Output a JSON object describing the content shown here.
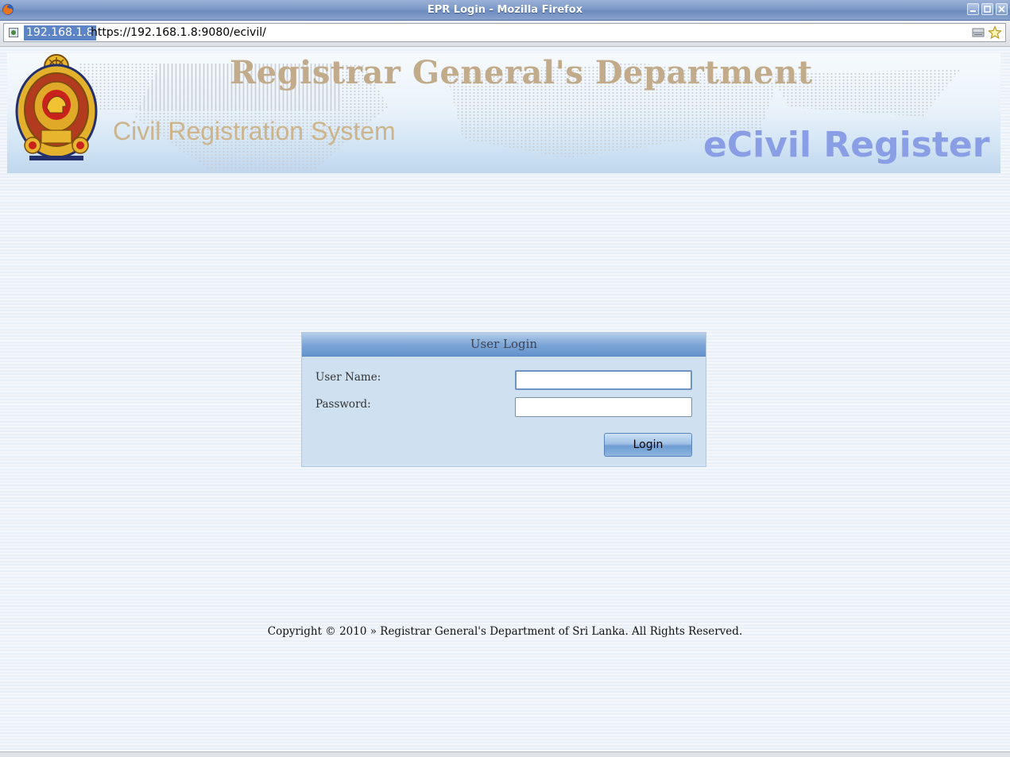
{
  "window": {
    "title": "EPR Login - Mozilla Firefox",
    "app_icon": "firefox-icon",
    "controls": [
      "minimize-icon",
      "maximize-icon",
      "close-icon"
    ]
  },
  "addressbar": {
    "identity": "192.168.1.8",
    "url": "https://192.168.1.8:9080/ecivil/",
    "icons": [
      "site-identity-icon",
      "rss-feed-icon",
      "bookmark-star-icon"
    ]
  },
  "banner": {
    "department": "Registrar General's Department",
    "subtitle": "Civil Registration System",
    "brand": "eCivil Register",
    "emblem": "sri-lanka-emblem-icon"
  },
  "login": {
    "header": "User Login",
    "username_label": "User Name:",
    "username_value": "",
    "password_label": "Password:",
    "password_value": "",
    "button_label": "Login"
  },
  "footer": {
    "copyright": "Copyright © 2010 » Registrar General's Department of Sri Lanka. All Rights Reserved."
  },
  "colors": {
    "title_bar": "#7c98c8",
    "department_title": "#c2ab8a",
    "brand_title": "#8a9ee6",
    "login_panel": "#cfe0f0",
    "login_header": "#6393cd"
  }
}
